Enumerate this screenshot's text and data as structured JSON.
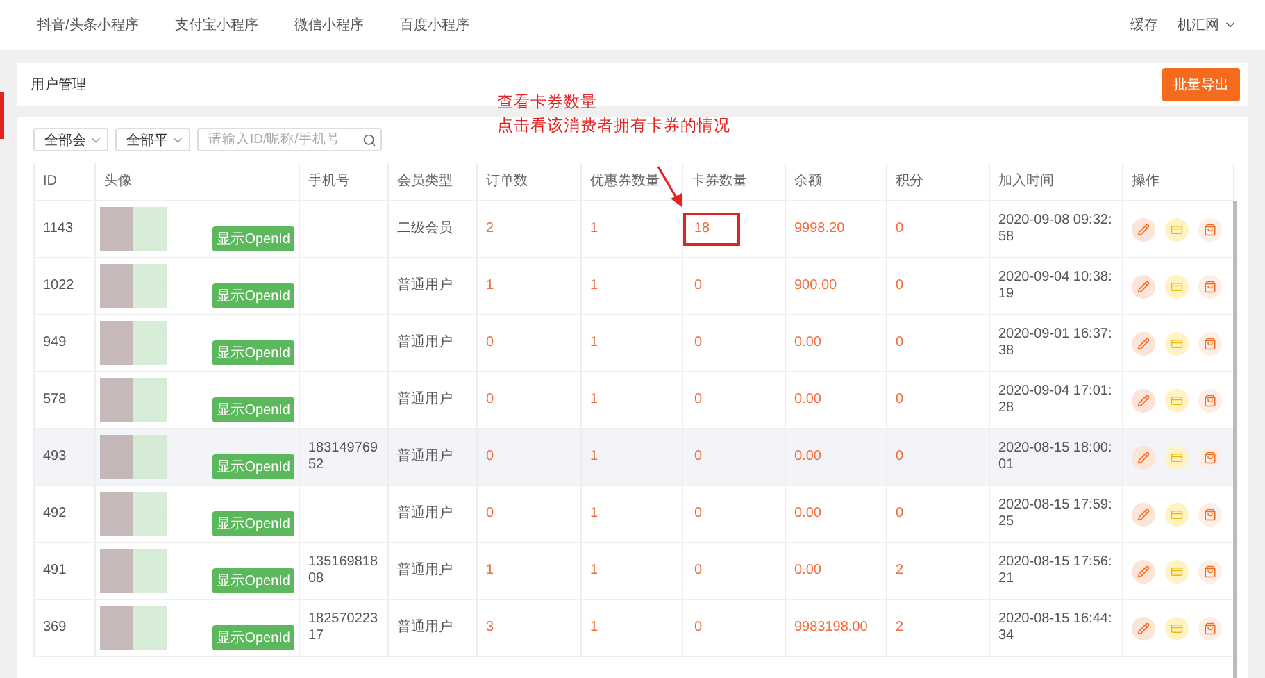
{
  "top_nav": {
    "tabs": [
      "抖音/头条小程序",
      "支付宝小程序",
      "微信小程序",
      "百度小程序"
    ],
    "right": {
      "cache": "缓存",
      "account": "机汇网"
    }
  },
  "header": {
    "title": "用户管理",
    "export_button": "批量导出"
  },
  "annotation": {
    "lines": [
      "查看卡券数量",
      "点击看该消费者拥有卡券的情况"
    ]
  },
  "filters": {
    "member_select": "全部会",
    "platform_select": "全部平",
    "search": {
      "placeholder": "请输入ID/昵称/手机号"
    }
  },
  "table": {
    "columns": [
      "ID",
      "头像",
      "手机号",
      "会员类型",
      "订单数",
      "优惠券数量",
      "卡券数量",
      "余额",
      "积分",
      "加入时间",
      "操作"
    ],
    "rows": [
      {
        "id": "1143",
        "openid_button": "显示OpenId",
        "phone": "",
        "member_type": "二级会员",
        "orders": "2",
        "coupons": "1",
        "cards": "18",
        "cards_marked": true,
        "balance": "9998.20",
        "points": "0",
        "joined": "2020-09-08 09:32:58",
        "highlighted": false
      },
      {
        "id": "1022",
        "openid_button": "显示OpenId",
        "phone": "",
        "member_type": "普通用户",
        "orders": "1",
        "coupons": "1",
        "cards": "0",
        "cards_marked": false,
        "balance": "900.00",
        "points": "0",
        "joined": "2020-09-04 10:38:19",
        "highlighted": false
      },
      {
        "id": "949",
        "openid_button": "显示OpenId",
        "phone": "",
        "member_type": "普通用户",
        "orders": "0",
        "coupons": "1",
        "cards": "0",
        "cards_marked": false,
        "balance": "0.00",
        "points": "0",
        "joined": "2020-09-01 16:37:38",
        "highlighted": false
      },
      {
        "id": "578",
        "openid_button": "显示OpenId",
        "phone": "",
        "member_type": "普通用户",
        "orders": "0",
        "coupons": "1",
        "cards": "0",
        "cards_marked": false,
        "balance": "0.00",
        "points": "0",
        "joined": "2020-09-04 17:01:28",
        "highlighted": false
      },
      {
        "id": "493",
        "openid_button": "显示OpenId",
        "phone": "18314976952",
        "member_type": "普通用户",
        "orders": "0",
        "coupons": "1",
        "cards": "0",
        "cards_marked": false,
        "balance": "0.00",
        "points": "0",
        "joined": "2020-08-15 18:00:01",
        "highlighted": true
      },
      {
        "id": "492",
        "openid_button": "显示OpenId",
        "phone": "",
        "member_type": "普通用户",
        "orders": "0",
        "coupons": "1",
        "cards": "0",
        "cards_marked": false,
        "balance": "0.00",
        "points": "0",
        "joined": "2020-08-15 17:59:25",
        "highlighted": false
      },
      {
        "id": "491",
        "openid_button": "显示OpenId",
        "phone": "13516981808",
        "member_type": "普通用户",
        "orders": "1",
        "coupons": "1",
        "cards": "0",
        "cards_marked": false,
        "balance": "0.00",
        "points": "2",
        "joined": "2020-08-15 17:56:21",
        "highlighted": false
      },
      {
        "id": "369",
        "openid_button": "显示OpenId",
        "phone": "18257022317",
        "member_type": "普通用户",
        "orders": "3",
        "coupons": "1",
        "cards": "0",
        "cards_marked": false,
        "balance": "9983198.00",
        "points": "2",
        "joined": "2020-08-15 16:44:34",
        "highlighted": false
      }
    ]
  }
}
